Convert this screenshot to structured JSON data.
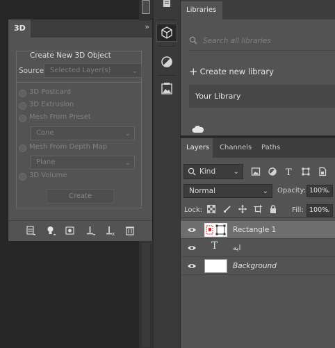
{
  "panel3d": {
    "tab_label": "3D",
    "collapse_label": "»",
    "group_title": "Create New 3D Object",
    "source_label": "Source:",
    "source_value": "Selected Layer(s)",
    "options": [
      "3D Postcard",
      "3D Extrusion",
      "Mesh From Preset",
      "Mesh From Depth Map",
      "3D Volume"
    ],
    "preset_value": "Cone",
    "depth_map_value": "Plane",
    "create_label": "Create"
  },
  "libraries": {
    "tab_label": "Libraries",
    "search_placeholder": "Search all libraries",
    "new_library_label": "Create new library",
    "your_library_label": "Your Library"
  },
  "layers_panel": {
    "tabs": [
      "Layers",
      "Channels",
      "Paths"
    ],
    "filter_label": "Kind",
    "blend_mode": "Normal",
    "opacity_label": "Opacity:",
    "opacity_value": "100%",
    "lock_label": "Lock:",
    "fill_label": "Fill:",
    "fill_value": "100%",
    "layers": [
      {
        "name": "Rectangle 1",
        "kind": "shape",
        "selected": true
      },
      {
        "name": "ایه",
        "kind": "text",
        "selected": false
      },
      {
        "name": "Background",
        "kind": "pixel",
        "selected": false
      }
    ]
  },
  "colors": {
    "panel_bg": "#535353",
    "dark_bg": "#262626",
    "selected_layer": "#6e6e6e",
    "shape_accent": "#d42b2b"
  }
}
